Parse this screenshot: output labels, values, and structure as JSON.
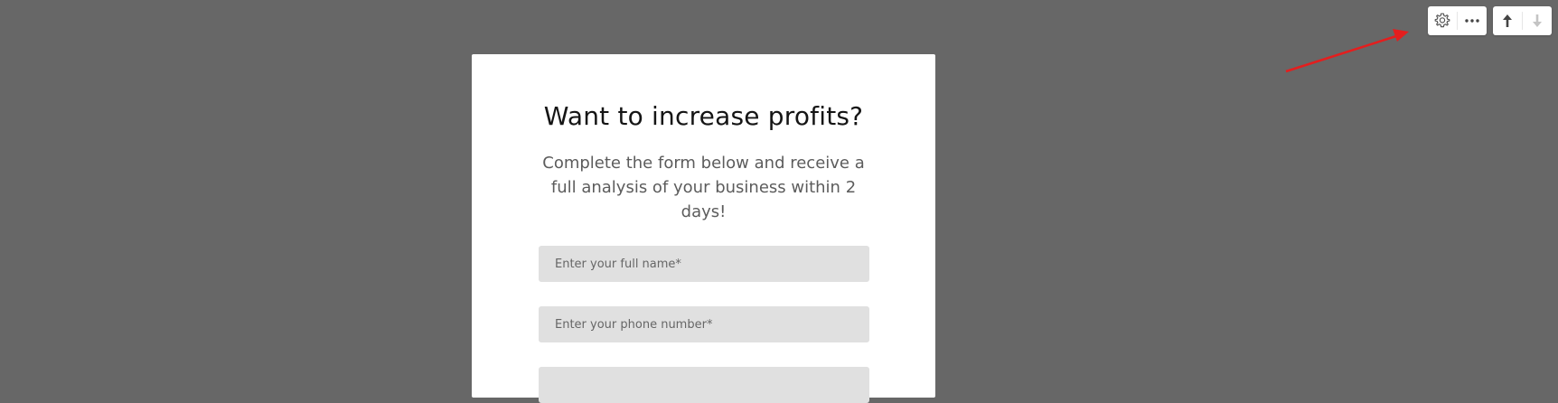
{
  "form": {
    "title": "Want to increase profits?",
    "subtitle": "Complete the form below and receive a full analysis of your business within 2 days!",
    "fields": {
      "name_placeholder": "Enter your full name*",
      "phone_placeholder": "Enter your phone number*",
      "third_placeholder": ""
    }
  },
  "toolbar": {
    "settings_icon": "gear-icon",
    "more_icon": "more-dots-icon",
    "move_up_icon": "arrow-up-icon",
    "move_down_icon": "arrow-down-icon"
  },
  "annotation": {
    "arrow_color": "#e41e1e"
  },
  "colors": {
    "backdrop": "#676767",
    "card": "#ffffff",
    "field_bg": "#e0e0e0"
  }
}
